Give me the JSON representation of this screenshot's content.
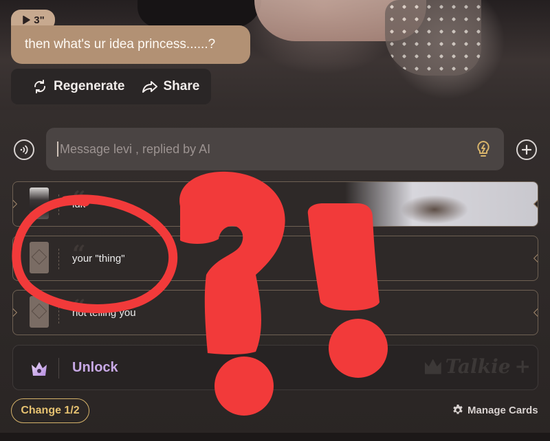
{
  "message": {
    "voice_duration": "3\"",
    "text": "then what's ur idea princess......?"
  },
  "actions": {
    "regenerate": "Regenerate",
    "share": "Share"
  },
  "composer": {
    "placeholder": "Message levi , replied by AI"
  },
  "cards": [
    {
      "text": "idk",
      "thumb": "photo"
    },
    {
      "text": "your \"thing\"",
      "thumb": "placeholder"
    },
    {
      "text": "not telling you",
      "thumb": "placeholder"
    }
  ],
  "unlock": {
    "label": "Unlock",
    "brand": "Talkie"
  },
  "footer": {
    "change_label": "Change 1/2",
    "manage_label": "Manage Cards"
  },
  "colors": {
    "bubble": "#b29174",
    "accent_gold": "#e6c271",
    "unlock_purple": "#c8a9e6",
    "annotation_red": "#f23a3a"
  }
}
